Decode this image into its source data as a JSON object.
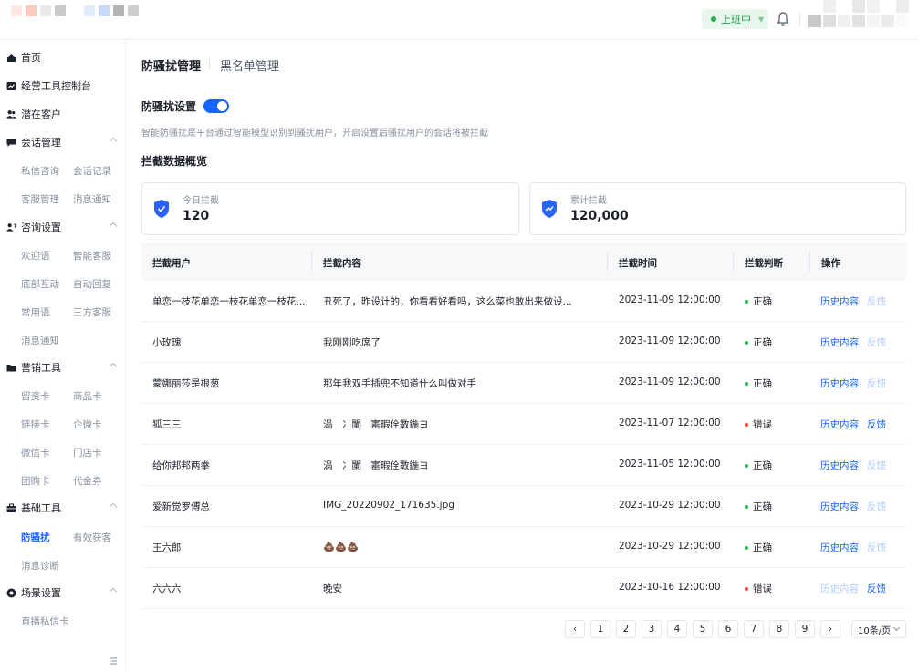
{
  "header": {
    "status_label": "上班中",
    "colors": {
      "status_bg": "#e8f7ee",
      "status_text": "#1f9a48"
    }
  },
  "sidebar": {
    "items": [
      {
        "label": "首页",
        "icon": "home-icon"
      },
      {
        "label": "经营工具控制台",
        "icon": "dashboard-icon"
      },
      {
        "label": "潜在客户",
        "icon": "users-icon"
      },
      {
        "label": "会话管理",
        "icon": "chat-icon",
        "sub": [
          "私信咨询",
          "会话记录",
          "客服管理",
          "消息通知"
        ]
      },
      {
        "label": "咨询设置",
        "icon": "consult-icon",
        "sub": [
          "欢迎语",
          "智能客服",
          "底部互动",
          "自动回复",
          "常用语",
          "三方客服",
          "消息通知"
        ]
      },
      {
        "label": "营销工具",
        "icon": "folder-icon",
        "sub": [
          "留资卡",
          "商品卡",
          "链接卡",
          "企微卡",
          "微信卡",
          "门店卡",
          "团购卡",
          "代金券"
        ]
      },
      {
        "label": "基础工具",
        "icon": "toolbox-icon",
        "sub": [
          "防骚扰",
          "有效获客",
          "消息诊断"
        ]
      },
      {
        "label": "场景设置",
        "icon": "scene-icon",
        "sub": [
          "直播私信卡"
        ]
      }
    ],
    "active_sub": "防骚扰"
  },
  "tabs": {
    "active": "防骚扰管理",
    "other": "黑名单管理"
  },
  "setting": {
    "title": "防骚扰设置",
    "enabled": true,
    "description": "智能防骚扰是平台通过智能模型识别到骚扰用户，开启设置后骚扰用户的会话将被拦截"
  },
  "overview": {
    "title": "拦截数据概览",
    "today_label": "今日拦截",
    "today_value": "120",
    "total_label": "累计拦截",
    "total_value": "120,000"
  },
  "table": {
    "headers": [
      "拦截用户",
      "拦截内容",
      "拦截时间",
      "拦截判断",
      "操作"
    ],
    "rows": [
      {
        "user": "单恋一枝花单恋一枝花单恋一枝花...",
        "content": "丑死了，昨设计的，你看看好看吗，这么菜也敢出来做设...",
        "time": "2023-11-09 12:00:00",
        "judge": "正确",
        "ok": true,
        "history": "历史内容",
        "feedback": "反馈",
        "history_disabled": false,
        "feedback_disabled": true
      },
      {
        "user": "小玫瑰",
        "content": "我刚刚吃席了",
        "time": "2023-11-09 12:00:00",
        "judge": "正确",
        "ok": true,
        "history": "历史内容",
        "feedback": "反馈",
        "history_disabled": false,
        "feedback_disabled": true
      },
      {
        "user": "蒙娜丽莎是根葱",
        "content": "那年我双手插兜不知道什么叫做对手",
        "time": "2023-11-09 12:00:00",
        "judge": "正确",
        "ok": true,
        "history": "历史内容",
        "feedback": "反馈",
        "history_disabled": false,
        "feedback_disabled": true
      },
      {
        "user": "狐三三",
        "content": "涡　冫闌　寚暇佺斁鍦ヨ",
        "time": "2023-11-07 12:00:00",
        "judge": "错误",
        "ok": false,
        "history": "历史内容",
        "feedback": "反馈",
        "history_disabled": false,
        "feedback_disabled": false
      },
      {
        "user": "给你邦邦两拳",
        "content": "涡　冫闌　寚暇佺斁鍦ヨ",
        "time": "2023-11-05 12:00:00",
        "judge": "正确",
        "ok": true,
        "history": "历史内容",
        "feedback": "反馈",
        "history_disabled": false,
        "feedback_disabled": true
      },
      {
        "user": "爱新觉罗傅总",
        "content": "IMG_20220902_171635.jpg",
        "time": "2023-10-29 12:00:00",
        "judge": "正确",
        "ok": true,
        "history": "历史内容",
        "feedback": "反馈",
        "history_disabled": false,
        "feedback_disabled": true
      },
      {
        "user": "王六郎",
        "content": "💩💩💩",
        "time": "2023-10-29 12:00:00",
        "judge": "正确",
        "ok": true,
        "history": "历史内容",
        "feedback": "反馈",
        "history_disabled": false,
        "feedback_disabled": true
      },
      {
        "user": "六六六",
        "content": "晚安",
        "time": "2023-10-16 12:00:00",
        "judge": "错误",
        "ok": false,
        "history": "历史内容",
        "feedback": "反馈",
        "history_disabled": true,
        "feedback_disabled": false
      }
    ],
    "colors": {
      "ok": "#22b14c",
      "err": "#f53f3f",
      "link": "#1664ff"
    }
  },
  "pagination": {
    "prev": "‹",
    "pages": [
      "1",
      "2",
      "3",
      "4",
      "5",
      "6",
      "7",
      "8",
      "9"
    ],
    "next": "›",
    "page_size": "10条/页"
  }
}
